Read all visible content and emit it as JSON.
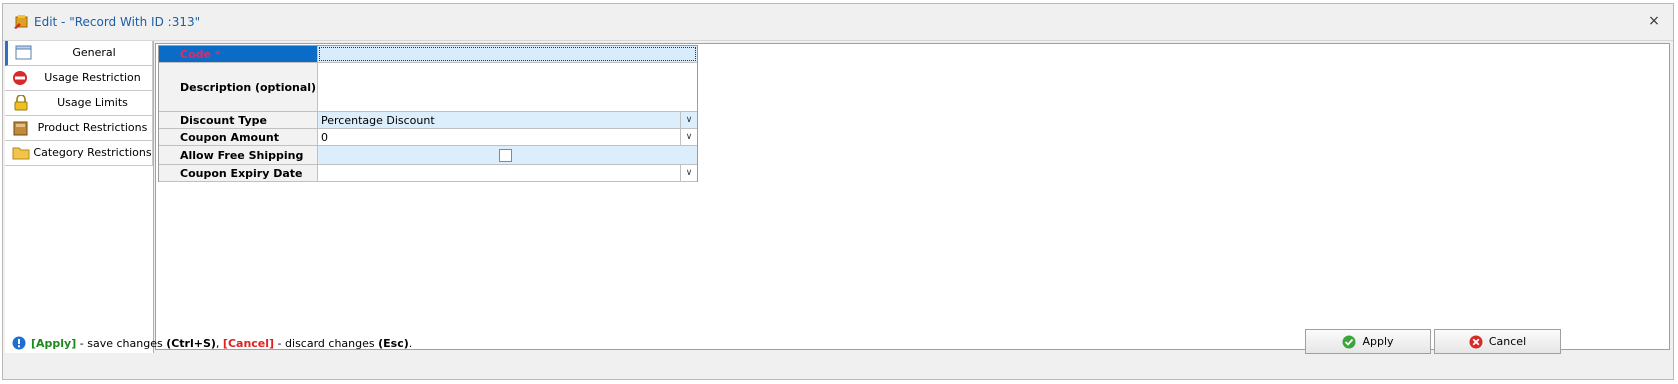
{
  "window": {
    "title": "Edit - \"Record With ID :313\"",
    "close_glyph": "×"
  },
  "sidebar": {
    "items": [
      {
        "label": "General",
        "icon": "window-icon",
        "active": true
      },
      {
        "label": "Usage Restriction",
        "icon": "no-entry-icon"
      },
      {
        "label": "Usage Limits",
        "icon": "lock-icon"
      },
      {
        "label": "Product Restrictions",
        "icon": "box-icon"
      },
      {
        "label": "Category Restrictions",
        "icon": "folder-icon"
      }
    ]
  },
  "form": {
    "rows": [
      {
        "caption": "Code *",
        "value": ""
      },
      {
        "caption": "Description (optional)",
        "value": ""
      },
      {
        "caption": "Discount Type",
        "value": "Percentage Discount"
      },
      {
        "caption": "Coupon Amount",
        "value": "0"
      },
      {
        "caption": "Allow Free Shipping",
        "value": false
      },
      {
        "caption": "Coupon Expiry Date",
        "value": ""
      }
    ]
  },
  "status": {
    "apply_tag": "[Apply]",
    "apply_text": " - save changes ",
    "apply_shortcut": "(Ctrl+S)",
    "comma": ", ",
    "cancel_tag": "[Cancel]",
    "cancel_text": " - discard changes ",
    "cancel_shortcut": "(Esc)",
    "period": "."
  },
  "buttons": {
    "apply": "Apply",
    "cancel": "Cancel"
  },
  "colors": {
    "accent": "#0a6cc6",
    "title": "#1e5ea8",
    "required": "#e02a6a"
  }
}
